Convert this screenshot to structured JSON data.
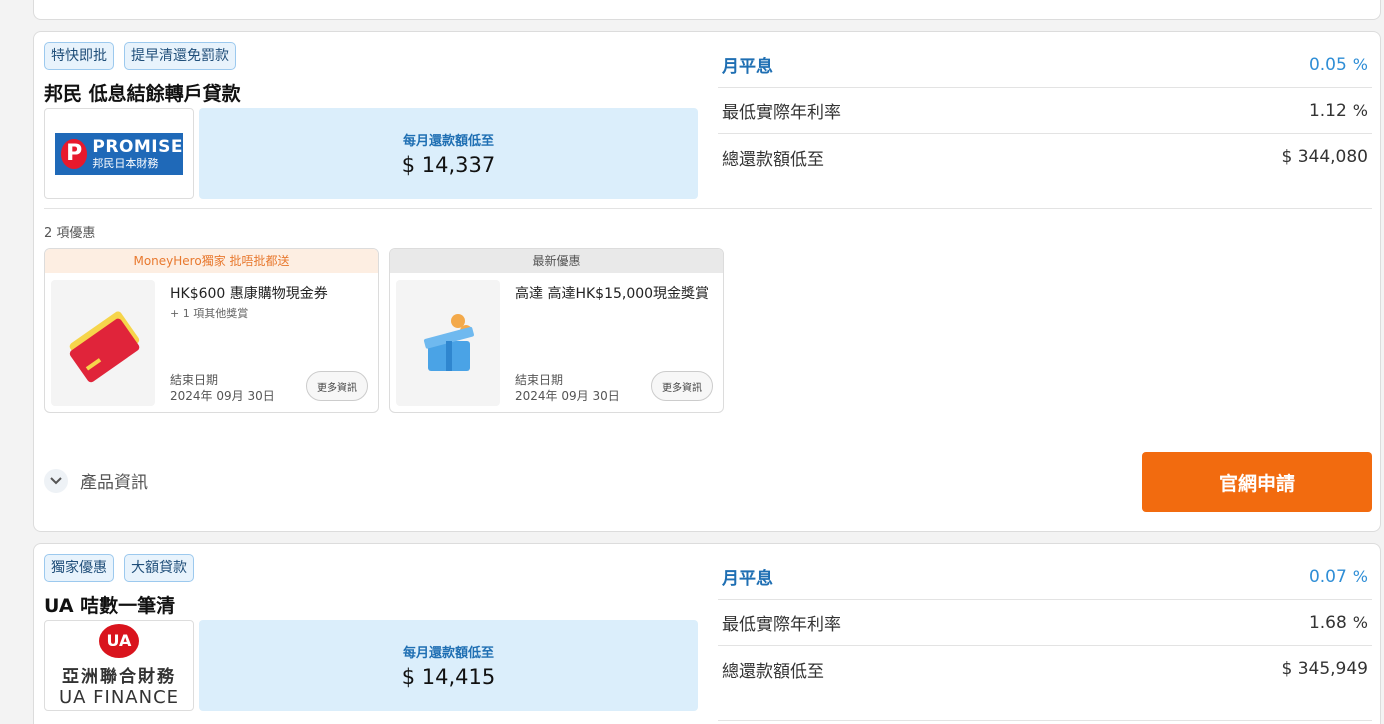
{
  "cards": [
    {
      "tags": [
        "特快即批",
        "提早清還免罰款"
      ],
      "name": "邦民 低息結餘轉戶貸款",
      "logo": {
        "name": "promise-logo",
        "text": "PROMISE",
        "subtext": "邦民日本財務"
      },
      "monthly": {
        "label": "每月還款額低至",
        "value": "$ 14,337"
      },
      "rates": [
        {
          "label": "月平息",
          "value": "0.05",
          "unit": "%"
        },
        {
          "label": "最低實際年利率",
          "value": "1.12",
          "unit": "%"
        },
        {
          "label": "總還款額低至",
          "value": "$ 344,080",
          "unit": ""
        }
      ],
      "offers_count": "2 項優惠",
      "offers": [
        {
          "header": "MoneyHero獨家 批唔批都送",
          "title": "HK$600 惠康購物現金券",
          "subtitle": "+ 1 項其他獎賞",
          "end_label": "結束日期",
          "end_date": "2024年 09月 30日",
          "more": "更多資訊",
          "image_icon": "gift-card-icon"
        },
        {
          "header": "最新優惠",
          "title": "高達 高達HK$15,000現金獎賞",
          "subtitle": "",
          "end_label": "結束日期",
          "end_date": "2024年 09月 30日",
          "more": "更多資訊",
          "image_icon": "gift-box-icon"
        }
      ],
      "product_info": "產品資訊",
      "apply": "官網申請"
    },
    {
      "tags": [
        "獨家優惠",
        "大額貸款"
      ],
      "name": "UA 咭數一筆清",
      "logo": {
        "name": "ua-finance-logo",
        "mark": "UA",
        "cn": "亞洲聯合財務",
        "en": "UA FINANCE"
      },
      "monthly": {
        "label": "每月還款額低至",
        "value": "$ 14,415"
      },
      "rates": [
        {
          "label": "月平息",
          "value": "0.07",
          "unit": "%"
        },
        {
          "label": "最低實際年利率",
          "value": "1.68",
          "unit": "%"
        },
        {
          "label": "總還款額低至",
          "value": "$ 345,949",
          "unit": ""
        }
      ]
    }
  ],
  "colors": {
    "accent_blue": "#1f6fb3",
    "apply_orange": "#f26b0f",
    "tag_bg": "#e8f3fc"
  }
}
